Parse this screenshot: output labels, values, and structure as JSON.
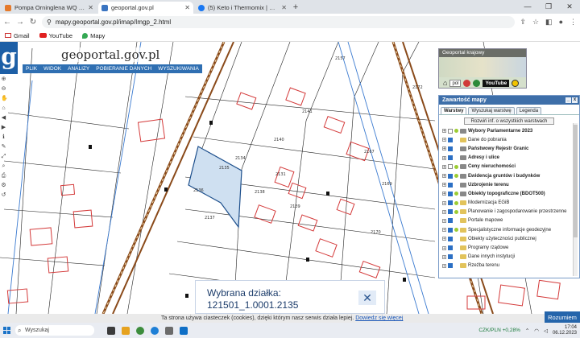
{
  "browser": {
    "tabs": [
      {
        "title": "Pompa Orninglena WQ 180F (51...",
        "favicon_color": "#e57a2b",
        "active": false
      },
      {
        "title": "geoportal.gov.pl",
        "favicon_color": "#3a74c1",
        "active": true
      },
      {
        "title": "(5) Keto i Thermomix | Facebook",
        "favicon_color": "#1877f2",
        "active": false
      }
    ],
    "new_tab": "+",
    "url": "mapy.geoportal.gov.pl/imap/Imgp_2.html",
    "bookmarks": [
      "Gmail",
      "YouTube",
      "Mapy"
    ]
  },
  "header": {
    "logo_letter": "g",
    "site_name": "geoportal.gov.pl",
    "menu": [
      "PLIK",
      "WIDOK",
      "ANALIZY",
      "POBIERANIE DANYCH",
      "WYSZUKIWANIA"
    ]
  },
  "left_tools": [
    "⊕",
    "⊖",
    "✋",
    "⌂",
    "◀",
    "▶",
    "ℹ",
    "✎",
    "⤢",
    "⌕",
    "⎙",
    "⚙",
    "↺"
  ],
  "overview": {
    "title": "Geoportal krajowy",
    "select_value": "pol",
    "youtube_label": "YouTube"
  },
  "layer_panel": {
    "title": "Zawartość mapy",
    "tabs": [
      "Warstwy",
      "Wyszukaj warstwę",
      "Legenda"
    ],
    "collapse_label": "Rozwiń inf. o wszystkich warstwach",
    "layers": [
      {
        "label": "Wybory Parlamentarne 2023",
        "checked": false,
        "bold": true,
        "status": true
      },
      {
        "label": "Dane do pobrania",
        "checked": true,
        "bold": false,
        "status": false
      },
      {
        "label": "Państwowy Rejestr Granic",
        "checked": true,
        "bold": true,
        "status": false
      },
      {
        "label": "Adresy i ulice",
        "checked": true,
        "bold": true,
        "status": false
      },
      {
        "label": "Ceny nieruchomości",
        "checked": false,
        "bold": true,
        "status": true
      },
      {
        "label": "Ewidencja gruntów i budynków",
        "checked": true,
        "bold": true,
        "status": true
      },
      {
        "label": "Uzbrojenie terenu",
        "checked": true,
        "bold": true,
        "status": false
      },
      {
        "label": "Obiekty topograficzne (BDOT500)",
        "checked": true,
        "bold": true,
        "status": true
      },
      {
        "label": "Modernizacja EGiB",
        "checked": true,
        "bold": false,
        "status": true
      },
      {
        "label": "Planowanie i zagospodarowanie przestrzenne",
        "checked": true,
        "bold": false,
        "status": true
      },
      {
        "label": "Portale mapowe",
        "checked": true,
        "bold": false,
        "status": false
      },
      {
        "label": "Specjalistyczne informacje geodezyjne",
        "checked": true,
        "bold": false,
        "status": true
      },
      {
        "label": "Obiekty użyteczności publicznej",
        "checked": true,
        "bold": false,
        "status": false
      },
      {
        "label": "Programy rządowe",
        "checked": true,
        "bold": false,
        "status": false
      },
      {
        "label": "Dane innych instytucji",
        "checked": true,
        "bold": false,
        "status": false
      },
      {
        "label": "Rzeźba terenu",
        "checked": true,
        "bold": false,
        "status": false
      }
    ]
  },
  "selection_popup": {
    "label": "Wybrana działka:",
    "parcel_id": "121501_1.0001.2135",
    "close": "✕"
  },
  "parcel_numbers": [
    "2131",
    "2134",
    "2135",
    "2136",
    "2137",
    "2138",
    "2139",
    "2140",
    "2141",
    "2157",
    "2167",
    "2169",
    "2170",
    "2172"
  ],
  "cookie_bar": {
    "text": "Ta strona używa ciasteczek (cookies), dzięki którym nasz serwis działa lepiej.",
    "link": "Dowiedz się więcej",
    "button": "Rozumiem"
  },
  "taskbar": {
    "search_placeholder": "Wyszukaj",
    "stock": "CZK/PLN +0,28%",
    "time": "17:04",
    "date": "06.12.2023"
  },
  "colors": {
    "geoportal_blue": "#2f6fb2",
    "parcel_highlight": "#cfe0f1",
    "building_red": "#d43a3a",
    "railway": "#8a4a1a",
    "road_blue": "#3c7bd0"
  }
}
